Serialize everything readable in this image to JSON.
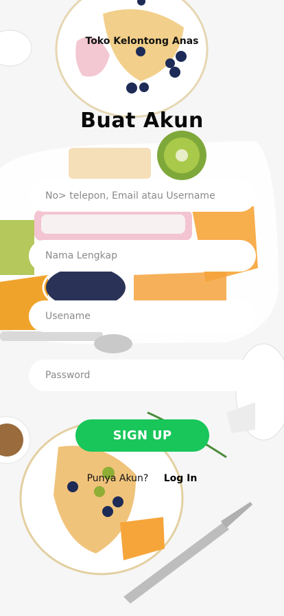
{
  "header": {
    "store_name": "Toko Kelontong Anas",
    "title": "Buat Akun"
  },
  "form": {
    "contact_placeholder": "No> telepon, Email atau Username",
    "fullname_placeholder": "Nama Lengkap",
    "username_placeholder": "Usename",
    "password_placeholder": "Password",
    "submit_label": "SIGN UP"
  },
  "footer": {
    "question": "Punya Akun?",
    "login_label": "Log In"
  },
  "colors": {
    "accent": "#18c65a",
    "background": "#f6f6f6"
  }
}
